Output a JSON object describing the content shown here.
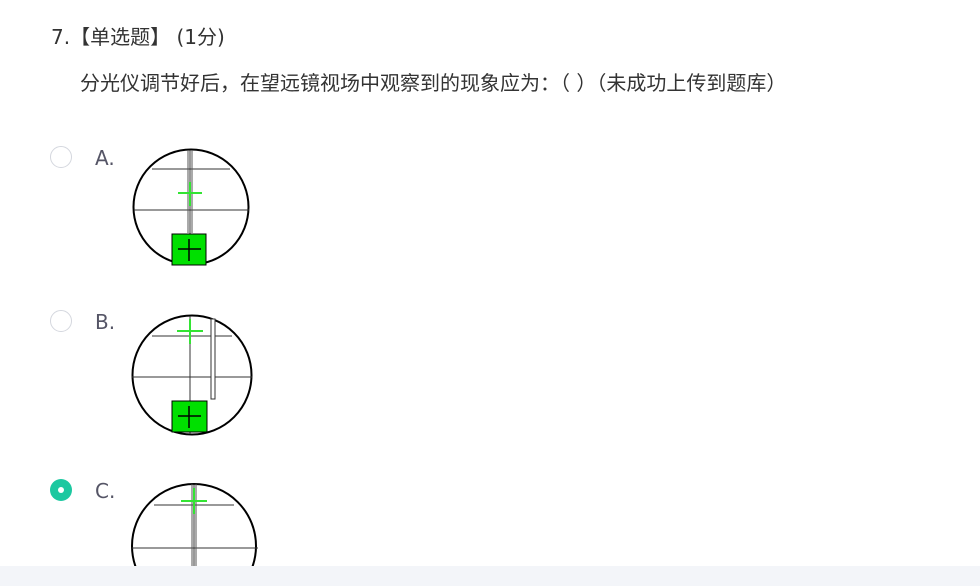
{
  "question": {
    "number": "7.",
    "type": "【单选题】",
    "score": "(1分)",
    "stem": "分光仪调节好后，在望远镜视场中观察到的现象应为：（ ）（未成功上传到题库）"
  },
  "options": [
    {
      "letter": "A.",
      "selected": false
    },
    {
      "letter": "B.",
      "selected": false
    },
    {
      "letter": "C.",
      "selected": true
    }
  ],
  "colors": {
    "accent": "#1cc8a0",
    "green": "#00e000",
    "lightgreen": "#33e433"
  },
  "icons": {
    "radio": "radio-circle-icon",
    "radio_checked": "radio-checked-icon"
  }
}
